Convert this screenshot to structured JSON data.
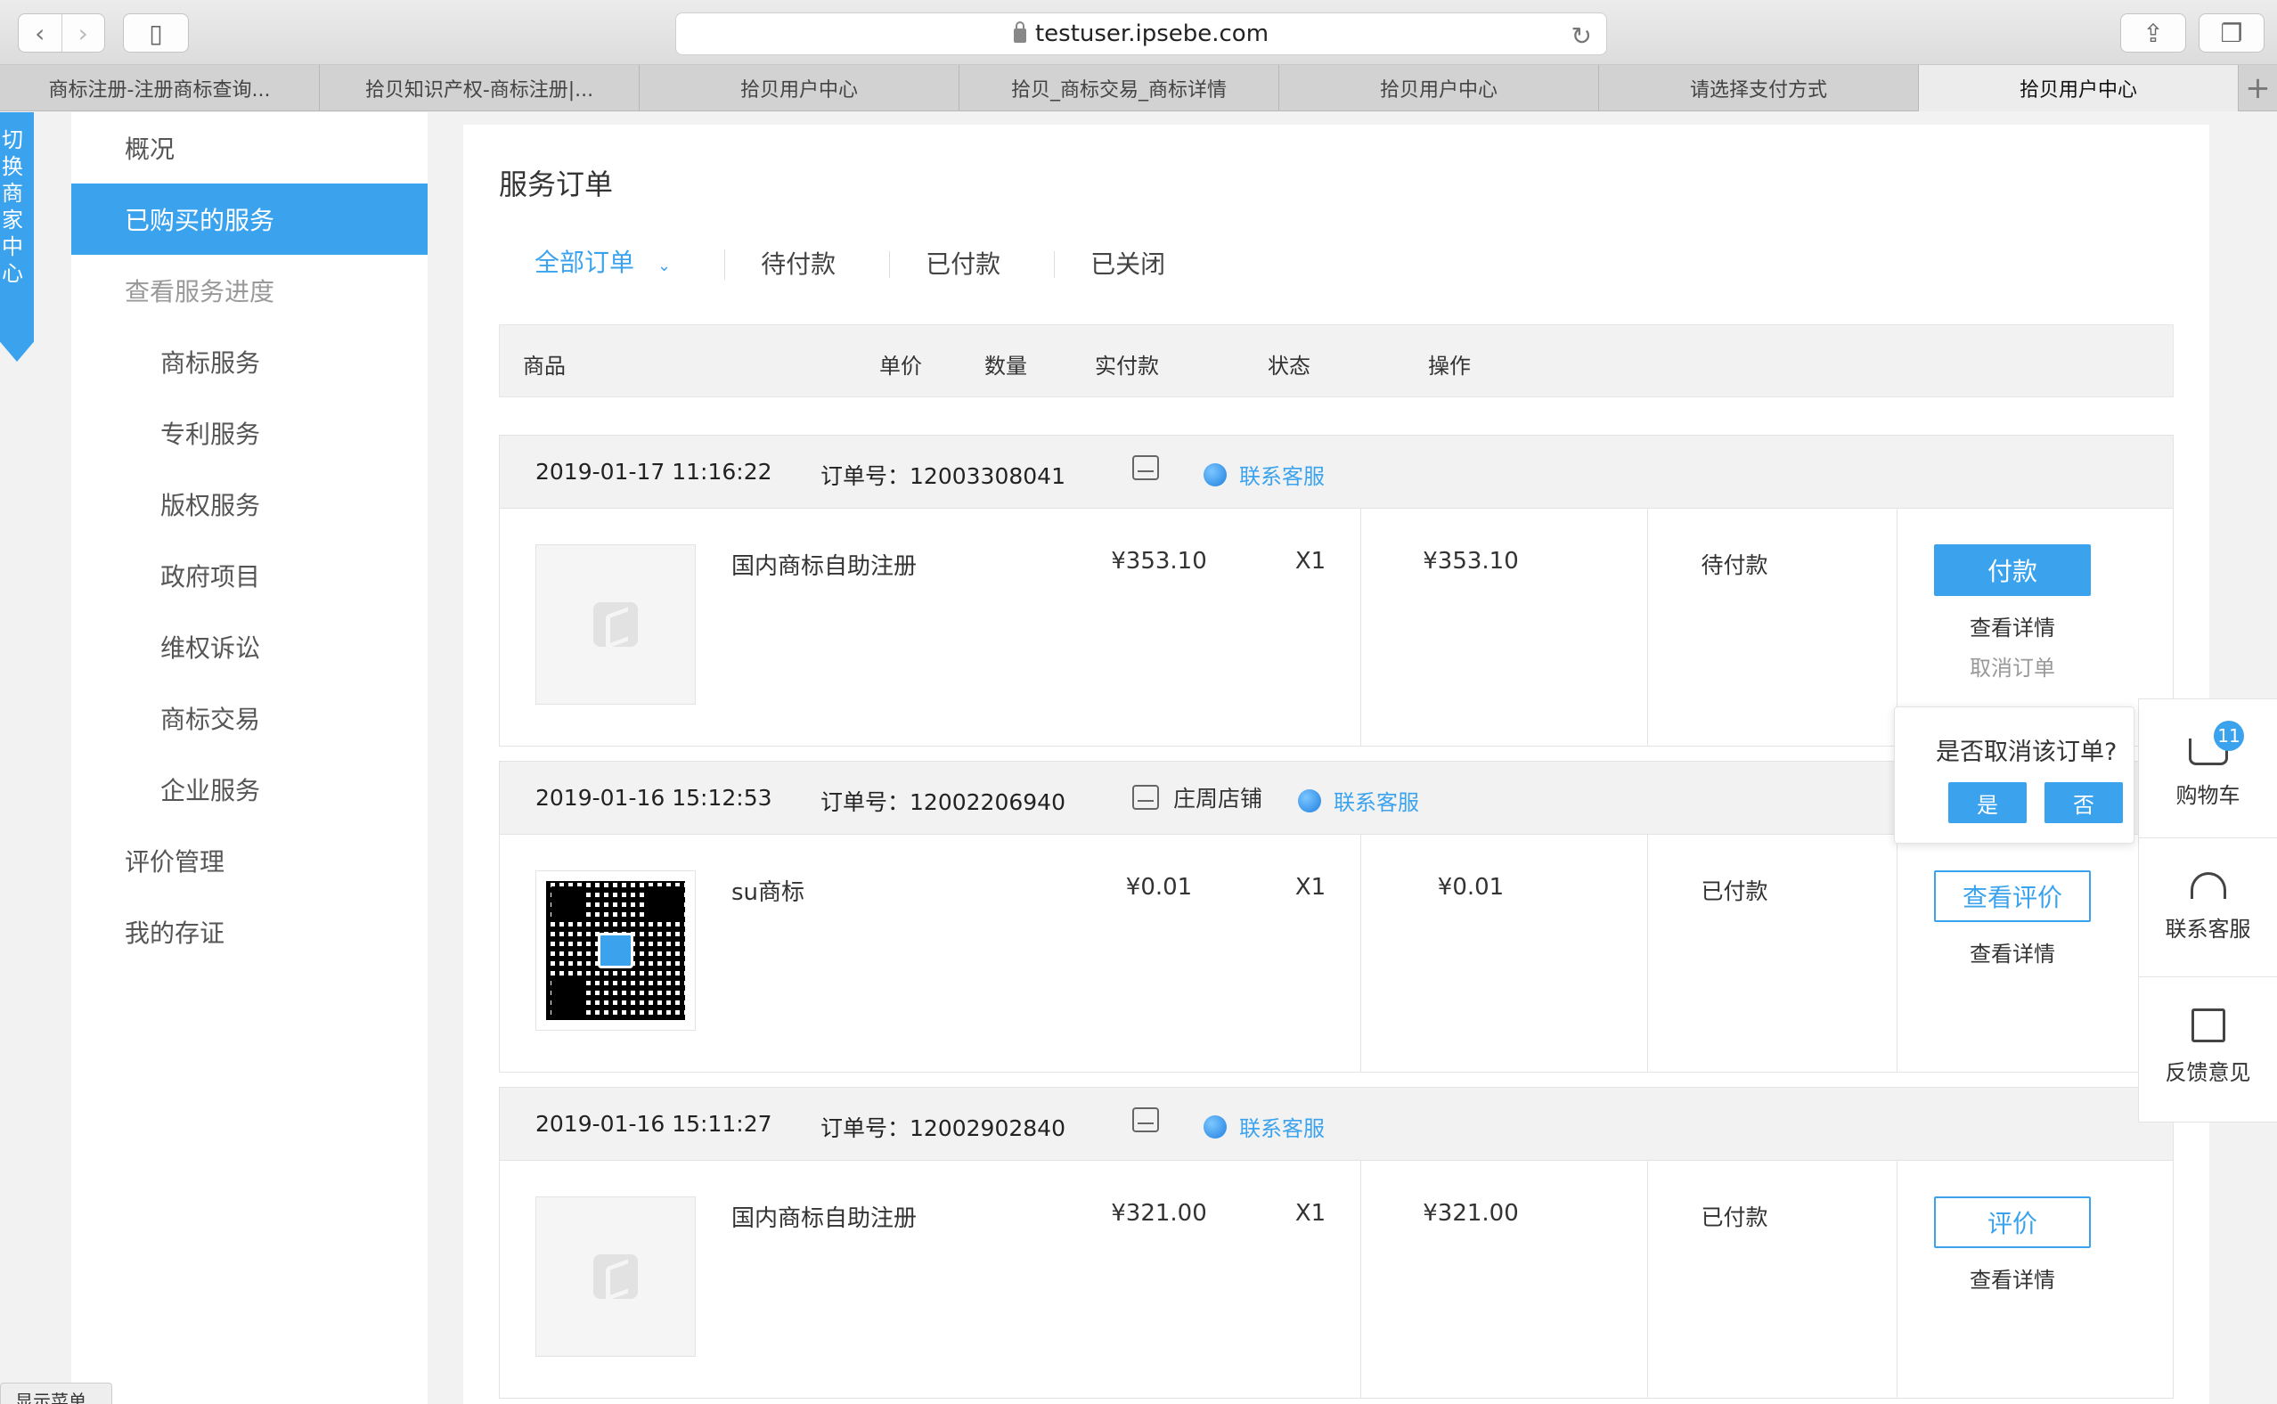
{
  "browser": {
    "url": "testuser.ipsebe.com",
    "tabs": [
      {
        "label": "商标注册-注册商标查询..."
      },
      {
        "label": "拾贝知识产权-商标注册|..."
      },
      {
        "label": "拾贝用户中心"
      },
      {
        "label": "拾贝_商标交易_商标详情"
      },
      {
        "label": "拾贝用户中心"
      },
      {
        "label": "请选择支付方式"
      },
      {
        "label": "拾贝用户中心"
      }
    ]
  },
  "switch_ribbon": "切换商家中心",
  "sidebar": {
    "items": [
      {
        "label": "概况"
      },
      {
        "label": "已购买的服务"
      },
      {
        "label": "查看服务进度"
      },
      {
        "label": "商标服务"
      },
      {
        "label": "专利服务"
      },
      {
        "label": "版权服务"
      },
      {
        "label": "政府项目"
      },
      {
        "label": "维权诉讼"
      },
      {
        "label": "商标交易"
      },
      {
        "label": "企业服务"
      },
      {
        "label": "评价管理"
      },
      {
        "label": "我的存证"
      }
    ],
    "show_menu": "显示菜单"
  },
  "main": {
    "title": "服务订单",
    "filters": [
      "全部订单",
      "待付款",
      "已付款",
      "已关闭"
    ],
    "columns": [
      "商品",
      "单价",
      "数量",
      "实付款",
      "状态",
      "操作"
    ],
    "order_no_label": "订单号：",
    "contact_label": "联系客服",
    "orders": [
      {
        "date": "2019-01-17 11:16:22",
        "order_no": "12003308041",
        "shop": "",
        "product": "国内商标自助注册",
        "price": "¥353.10",
        "qty": "X1",
        "paid": "¥353.10",
        "status": "待付款",
        "primary_action": "付款",
        "detail_link": "查看详情",
        "cancel_link": "取消订单"
      },
      {
        "date": "2019-01-16 15:12:53",
        "order_no": "12002206940",
        "shop": "庄周店铺",
        "product": "su商标",
        "price": "¥0.01",
        "qty": "X1",
        "paid": "¥0.01",
        "status": "已付款",
        "primary_action": "查看评价",
        "detail_link": "查看详情"
      },
      {
        "date": "2019-01-16 15:11:27",
        "order_no": "12002902840",
        "shop": "",
        "product": "国内商标自助注册",
        "price": "¥321.00",
        "qty": "X1",
        "paid": "¥321.00",
        "status": "已付款",
        "primary_action": "评价",
        "detail_link": "查看详情"
      }
    ]
  },
  "confirm_popover": {
    "question": "是否取消该订单?",
    "yes": "是",
    "no": "否"
  },
  "rightbar": {
    "cart_label": "购物车",
    "cart_count": "11",
    "service_label": "联系客服",
    "feedback_label": "反馈意见"
  }
}
